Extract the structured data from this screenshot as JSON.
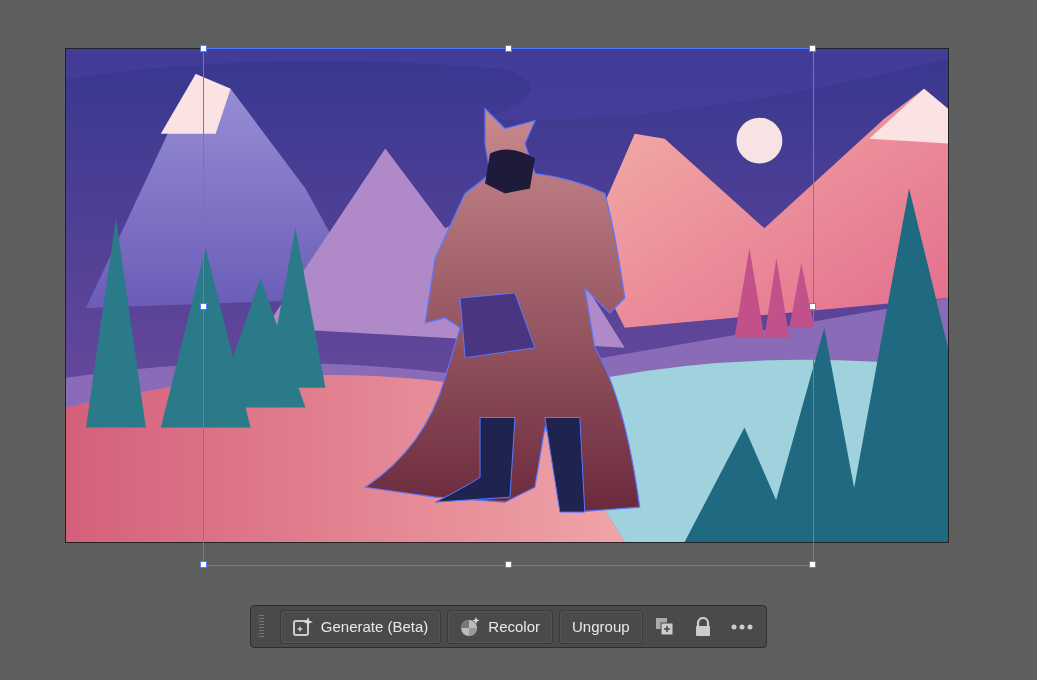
{
  "toolbar": {
    "buttons": [
      {
        "label": "Generate (Beta)",
        "kind": "generate"
      },
      {
        "label": "Recolor",
        "kind": "recolor"
      },
      {
        "label": "Ungroup",
        "kind": "plain"
      }
    ]
  }
}
